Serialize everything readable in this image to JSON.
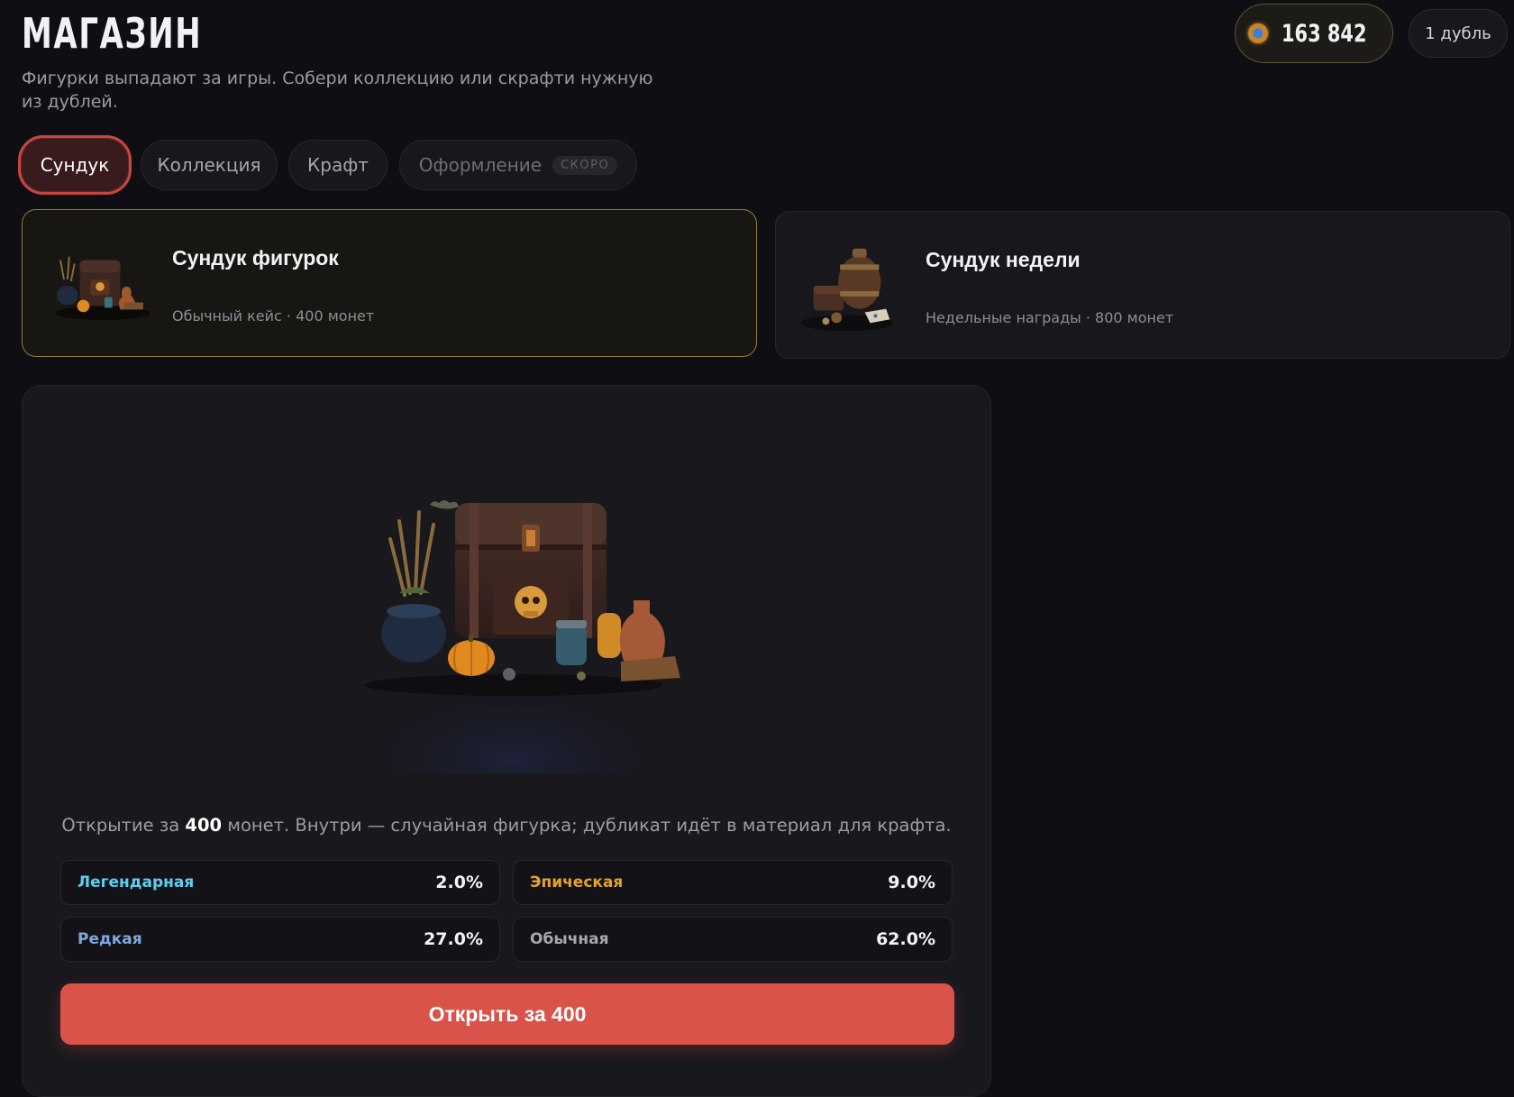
{
  "header": {
    "title": "МАГАЗИН",
    "subtitle": "Фигурки выпадают за игры. Собери коллекцию или скрафти нужную из дублей.",
    "coins": "163 842",
    "coin_icon": "coin-icon",
    "dupes": "1 дубль"
  },
  "tabs": [
    {
      "label": "Сундук",
      "active": true
    },
    {
      "label": "Коллекция",
      "active": false
    },
    {
      "label": "Крафт",
      "active": false
    },
    {
      "label": "Оформление",
      "badge": "СКОРО",
      "disabled": true
    }
  ],
  "cases": [
    {
      "name": "Сундук фигурок",
      "meta": "Обычный кейс · 400 монет",
      "selected": true,
      "icon": "treasure-chest-icon"
    },
    {
      "name": "Сундук недели",
      "meta": "Недельные награды · 800 монет",
      "selected": false,
      "icon": "weekly-chest-icon"
    }
  ],
  "panel": {
    "desc_prefix": "Открытие за ",
    "desc_price": "400",
    "desc_suffix": " монет. Внутри — случайная фигурка; дубликат идёт в материал для крафта.",
    "odds": [
      {
        "label": "Легендарная",
        "value": "2.0%",
        "color": "#5ecff0"
      },
      {
        "label": "Эпическая",
        "value": "9.0%",
        "color": "#e6a032"
      },
      {
        "label": "Редкая",
        "value": "27.0%",
        "color": "#7fa8e0"
      },
      {
        "label": "Обычная",
        "value": "62.0%",
        "color": "#a7a7ae"
      }
    ],
    "open_button": "Открыть за 400"
  },
  "colors": {
    "accent": "#d9534a",
    "background": "#0f0f13",
    "gold_border": "#8f7a3c"
  }
}
